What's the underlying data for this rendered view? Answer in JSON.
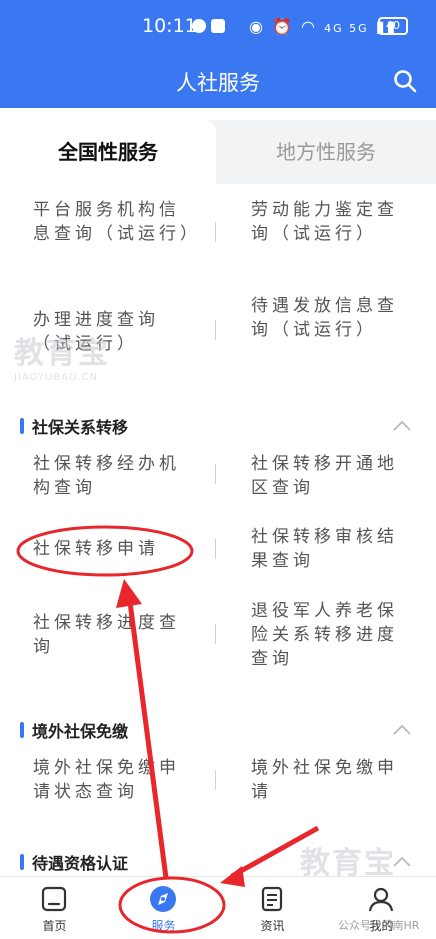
{
  "status_bar": {
    "time": "10:11",
    "network": "4G 5G",
    "battery": "40"
  },
  "header": {
    "title": "人社服务"
  },
  "tabs": [
    {
      "label": "全国性服务",
      "active": true
    },
    {
      "label": "地方性服务",
      "active": false
    }
  ],
  "top_rows": [
    {
      "left": "平台服务机构信息查询（试运行）",
      "right": "劳动能力鉴定查询（试运行）"
    },
    {
      "left": "办理进度查询（试运行）",
      "right": "待遇发放信息查询（试运行）"
    }
  ],
  "sections": [
    {
      "title": "社保关系转移",
      "rows": [
        {
          "left": "社保转移经办机构查询",
          "right": "社保转移开通地区查询"
        },
        {
          "left": "社保转移申请",
          "right": "社保转移审核结果查询"
        },
        {
          "left": "社保转移进度查询",
          "right": "退役军人养老保险关系转移进度查询"
        }
      ]
    },
    {
      "title": "境外社保免缴",
      "rows": [
        {
          "left": "境外社保免缴申请状态查询",
          "right": "境外社保免缴申请"
        }
      ]
    },
    {
      "title": "待遇资格认证",
      "rows": []
    }
  ],
  "bottom_nav": [
    {
      "label": "首页",
      "icon": "home-icon",
      "active": false
    },
    {
      "label": "服务",
      "icon": "compass-icon",
      "active": true
    },
    {
      "label": "资讯",
      "icon": "document-icon",
      "active": false
    },
    {
      "label": "我的",
      "icon": "person-icon",
      "active": false
    }
  ],
  "watermark": {
    "brand": "教育宝",
    "domain": "JIAOYUBAO.CN",
    "wechat": "公众号 · 河南HR"
  },
  "colors": {
    "primary": "#3a78f2",
    "annotation": "#e8262b"
  }
}
